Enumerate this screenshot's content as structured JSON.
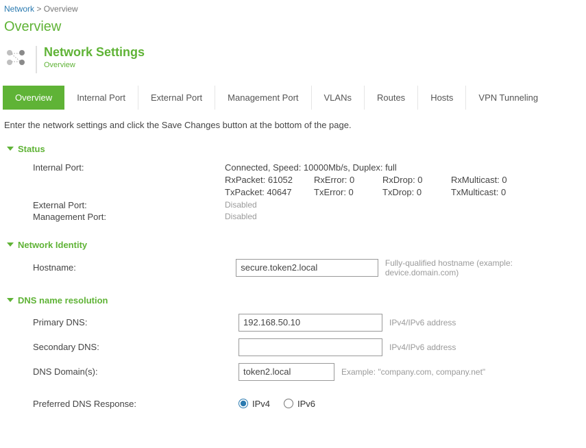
{
  "breadcrumb": {
    "root": "Network",
    "sep": " > ",
    "current": "Overview"
  },
  "page_title": "Overview",
  "header": {
    "title": "Network Settings",
    "subtitle": "Overview"
  },
  "tabs": [
    {
      "label": "Overview",
      "active": true
    },
    {
      "label": "Internal Port",
      "active": false
    },
    {
      "label": "External Port",
      "active": false
    },
    {
      "label": "Management Port",
      "active": false
    },
    {
      "label": "VLANs",
      "active": false
    },
    {
      "label": "Routes",
      "active": false
    },
    {
      "label": "Hosts",
      "active": false
    },
    {
      "label": "VPN Tunneling",
      "active": false
    }
  ],
  "instruction": "Enter the network settings and click the Save Changes button at the bottom of the page.",
  "sections": {
    "status": {
      "title": "Status",
      "internal": {
        "label": "Internal Port:",
        "summary": "Connected, Speed: 10000Mb/s, Duplex: full",
        "rx": {
          "packet": "RxPacket: 61052",
          "error": "RxError: 0",
          "drop": "RxDrop: 0",
          "multicast": "RxMulticast: 0"
        },
        "tx": {
          "packet": "TxPacket: 40647",
          "error": "TxError: 0",
          "drop": "TxDrop: 0",
          "multicast": "TxMulticast: 0"
        }
      },
      "external": {
        "label": "External Port:",
        "value": "Disabled"
      },
      "management": {
        "label": "Management Port:",
        "value": "Disabled"
      }
    },
    "identity": {
      "title": "Network Identity",
      "hostname": {
        "label": "Hostname:",
        "value": "secure.token2.local",
        "hint": "Fully-qualified hostname (example: device.domain.com)"
      }
    },
    "dns": {
      "title": "DNS name resolution",
      "primary": {
        "label": "Primary DNS:",
        "value": "192.168.50.10",
        "hint": "IPv4/IPv6 address"
      },
      "secondary": {
        "label": "Secondary DNS:",
        "value": "",
        "hint": "IPv4/IPv6 address"
      },
      "domains": {
        "label": "DNS Domain(s):",
        "value": "token2.local",
        "hint": "Example: \"company.com, company.net\""
      },
      "preferred": {
        "label": "Preferred DNS Response:",
        "ipv4": "IPv4",
        "ipv6": "IPv6",
        "selected": "ipv4"
      }
    }
  }
}
